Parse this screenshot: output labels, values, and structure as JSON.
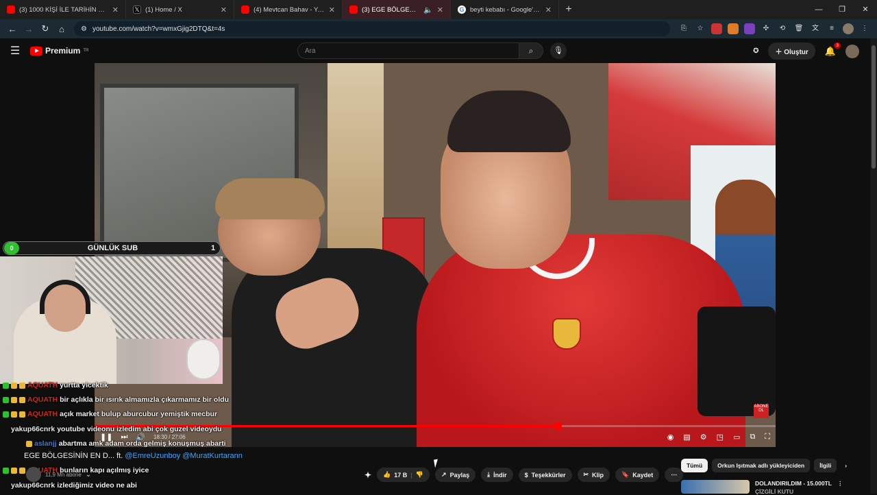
{
  "browser": {
    "tabs": [
      {
        "label": "(3) 1000 KİŞİ İLE TARİHİN EN İYİ",
        "color": "#ff0000"
      },
      {
        "label": "(1) Home / X",
        "color": "#000000"
      },
      {
        "label": "(4) Mevtcan Bahav - YouTube",
        "color": "#ff0000"
      },
      {
        "label": "(3) EGE BÖLGESİNİN EN D",
        "color": "#ff0000"
      },
      {
        "label": "beyti kebabı - Google'da Ara",
        "color": "#4285f4"
      }
    ],
    "url": "youtube.com/watch?v=wmxGjig2DTQ&t=4s"
  },
  "youtube": {
    "logo": "Premium",
    "logo_region": "TR",
    "search_placeholder": "Ara",
    "create_label": "Oluştur",
    "notif_count": "3"
  },
  "player": {
    "time": "18:30 / 27:06",
    "progress": 0.68,
    "end_logo": "ABONE OL"
  },
  "stream_overlay": {
    "badge": "0",
    "title": "GÜNLÜK SUB",
    "count": "1"
  },
  "chat": [
    {
      "user": "AQUATH",
      "msg": "yurtta yicektik",
      "color": "red"
    },
    {
      "user": "AQUATH",
      "msg": "bir açlıkla bir ısırık almamızla çıkarmamız bir oldu",
      "color": "red"
    },
    {
      "user": "AQUATH",
      "msg": "açık market bulup aburcubur yemiştik mecbur",
      "color": "red"
    },
    {
      "user": "yakup66cnrk",
      "msg": "youtube videonu izledim abi çok guzel videoydu",
      "color": "white"
    },
    {
      "user": "aslanjj",
      "msg": "abartma amk adam orda gelmiş konuşmuş abarti",
      "color": "blue"
    },
    {
      "user": "AQUATH",
      "msg": "bunların kapı açılmış iyice",
      "color": "red"
    },
    {
      "user": "yakup66cnrk",
      "msg": "izlediğimiz video ne abi",
      "color": "white"
    }
  ],
  "video": {
    "title_prefix": "EGE BÖLGESİNİN EN D... ft.",
    "mentions": "@EmreUzunboy @MuratKurtarann",
    "channel_subs": "11,9 Mn abone",
    "likes": "17 B",
    "share": "Paylaş",
    "download": "İndir",
    "thanks": "Teşekkürler",
    "clip": "Klip",
    "save": "Kaydet"
  },
  "recommend": {
    "chips": [
      "Tümü",
      "Orkun Işıtmak adlı yükleyiciden",
      "İlgili"
    ],
    "first_title": "DOLANDIRILDIM - 15.000TL",
    "first_sub": "ÇİZGİLİ KUTU"
  }
}
